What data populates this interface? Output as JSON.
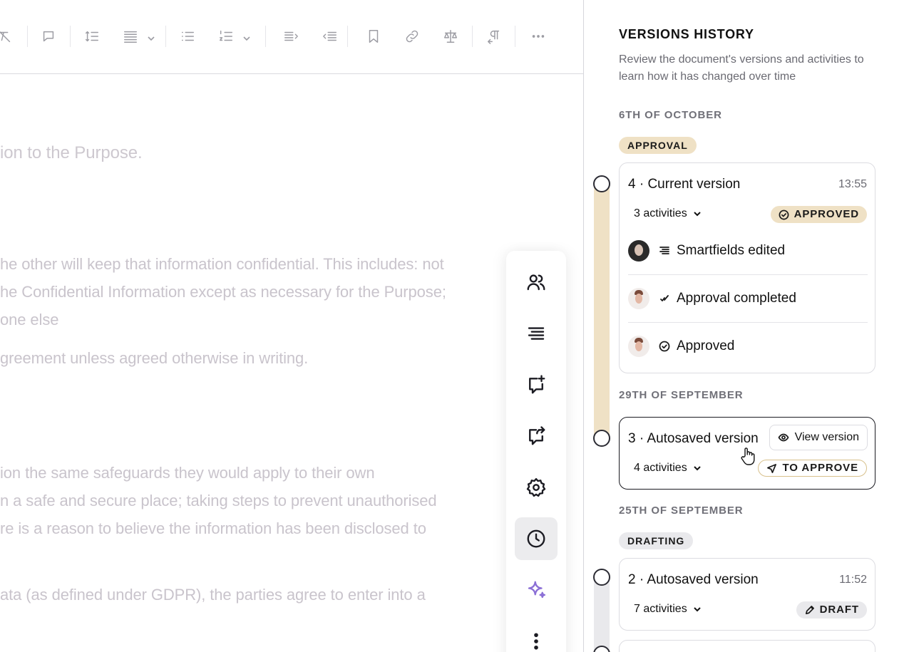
{
  "toolbar": {
    "tools": [
      {
        "name": "clear-format-icon"
      },
      {
        "name": "comment-icon"
      },
      {
        "name": "line-spacing-icon"
      },
      {
        "name": "align-justify-icon"
      },
      {
        "name": "bullet-list-icon"
      },
      {
        "name": "numbered-list-icon"
      },
      {
        "name": "indent-right-icon"
      },
      {
        "name": "indent-left-icon"
      },
      {
        "name": "bookmark-icon"
      },
      {
        "name": "link-icon"
      },
      {
        "name": "scales-icon"
      },
      {
        "name": "paragraph-direction-icon"
      },
      {
        "name": "more-icon"
      }
    ]
  },
  "document": {
    "lines": [
      "ion to the Purpose.",
      "he other will keep that information confidential. This includes: not",
      "he Confidential Information except as necessary for the Purpose;",
      "one else",
      "greement unless agreed otherwise in writing.",
      "ion the same safeguards they would apply to their own",
      "n a safe and secure place; taking steps to prevent unauthorised",
      "re is a reason to believe the information has been disclosed to",
      "ata (as defined under GDPR), the parties agree to enter into a"
    ]
  },
  "rail": {
    "buttons": [
      {
        "name": "users-icon"
      },
      {
        "name": "contents-icon"
      },
      {
        "name": "add-comment-icon"
      },
      {
        "name": "share-comment-icon"
      },
      {
        "name": "settings-icon"
      },
      {
        "name": "history-icon",
        "active": true
      },
      {
        "name": "ai-sparkle-icon"
      },
      {
        "name": "more-vertical-icon"
      }
    ]
  },
  "panel": {
    "title": "VERSIONS HISTORY",
    "subtitle": "Review the document's versions and activities to learn how it has changed over time",
    "groups": [
      {
        "date": "6TH OF OCTOBER",
        "phase": "APPROVAL",
        "versions": [
          {
            "title": "4 · Current version",
            "time": "13:55",
            "activities": "3 activities",
            "status": "APPROVED",
            "items": [
              {
                "text": "Smartfields edited",
                "icon": "smartfields-icon",
                "avatar": "avatar-user-1"
              },
              {
                "text": "Approval completed",
                "icon": "check-mark-icon",
                "avatar": "avatar-user-2"
              },
              {
                "text": "Approved",
                "icon": "check-circle-icon",
                "avatar": "avatar-user-2"
              }
            ]
          }
        ]
      },
      {
        "date": "29TH OF SEPTEMBER",
        "versions": [
          {
            "title": "3 · Autosaved version",
            "view_label": "View version",
            "activities": "4 activities",
            "status": "TO APPROVE"
          }
        ]
      },
      {
        "date": "25TH OF SEPTEMBER",
        "phase": "DRAFTING",
        "versions": [
          {
            "title": "2 · Autosaved version",
            "time": "11:52",
            "activities": "7 activities",
            "status": "DRAFT"
          }
        ]
      }
    ]
  },
  "colors": {
    "approval_accent": "#efe1c5",
    "drafting_accent": "#e9e9ec",
    "to_approve_border": "#d8c18c",
    "sparkle": "#8b6fd6"
  }
}
